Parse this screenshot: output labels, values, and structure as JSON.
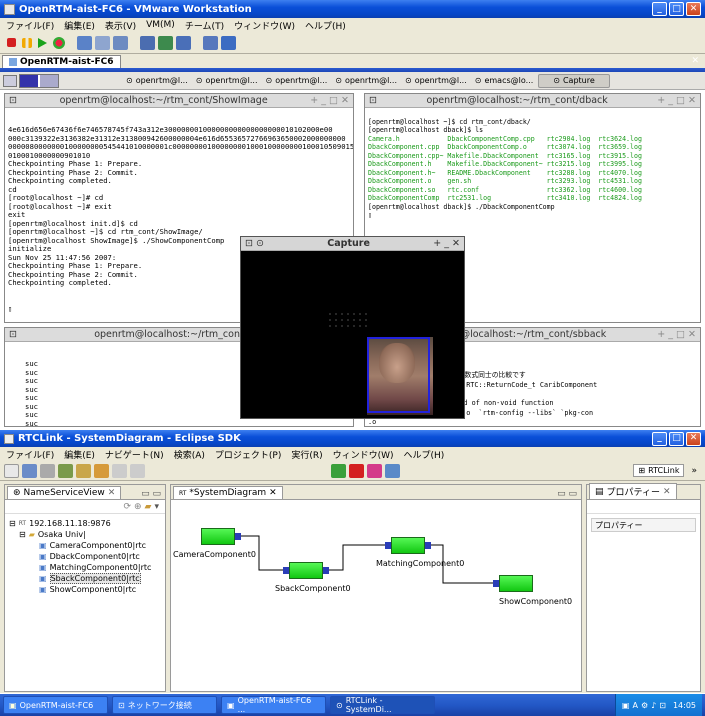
{
  "vmware": {
    "title": "OpenRTM-aist-FC6 - VMware Workstation",
    "menu": [
      "ファイル(F)",
      "編集(E)",
      "表示(V)",
      "VM(M)",
      "チーム(T)",
      "ウィンドウ(W)",
      "ヘルプ(H)"
    ],
    "tab_label": "OpenRTM-aist-FC6"
  },
  "gnome_panel": {
    "tasks": [
      "openrtm@l...",
      "openrtm@l...",
      "openrtm@l...",
      "openrtm@l...",
      "openrtm@l...",
      "emacs@lo...",
      "Capture"
    ]
  },
  "terminals": {
    "t1": {
      "title": "openrtm@localhost:~/rtm_cont/ShowImage",
      "lines": [
        "4e616d656e67436f6e746578745f743a312e300000001000000000000000000010102000e00",
        "000c3139322e3136382e31312e313800942600000004e616d65536572766963650002000000000",
        "0000080000000100000000545441010000001c000000001000000001000100000000100010509015",
        "0100010000000901010",
        "Checkpointing Phase 1: Prepare.",
        "Checkpointing Phase 2: Commit.",
        "Checkpointing completed.",
        "cd",
        "[root@localhost ~]# cd",
        "[root@localhost ~]# exit",
        "exit",
        "[openrtm@localhost init.d]$ cd",
        "[openrtm@localhost ~]$ cd rtm_cont/ShowImage/",
        "[openrtm@localhost ShowImage]$ ./ShowComponentComp",
        "initialize",
        "",
        "Sun Nov 25 11:47:56 2007:",
        "",
        "Checkpointing Phase 1: Prepare.",
        "Checkpointing Phase 2: Commit.",
        "Checkpointing completed."
      ]
    },
    "t2": {
      "title": "openrtm@localhost:~/rtm_cont/dback",
      "line1": "[openrtm@localhost ~]$ cd rtm_cont/dback/",
      "line2": "[openrtm@localhost dback]$ ls",
      "ls_rows": [
        [
          "Camera.h",
          "DbackComponentComp.cpp",
          "rtc2904.log",
          "rtc3624.log"
        ],
        [
          "DbackComponent.cpp",
          "DbackComponentComp.o",
          "rtc3074.log",
          "rtc3659.log"
        ],
        [
          "DbackComponent.cpp~",
          "Makefile.DbackComponent",
          "rtc3165.log",
          "rtc3915.log"
        ],
        [
          "DbackComponent.h",
          "Makefile.DbackComponent~",
          "rtc3215.log",
          "rtc3995.log"
        ],
        [
          "DbackComponent.h~",
          "README.DbackComponent",
          "rtc3288.log",
          "rtc4070.log"
        ],
        [
          "DbackComponent.o",
          "gen.sh",
          "rtc3293.log",
          "rtc4531.log"
        ],
        [
          "DbackComponent.so",
          "rtc.conf",
          "rtc3362.log",
          "rtc4600.log"
        ],
        [
          "DbackComponentComp",
          "rtc2531.log",
          "rtc3410.log",
          "rtc4824.log"
        ]
      ],
      "last": "[openrtm@localhost dback]$ ./DbackComponentComp"
    },
    "t3": {
      "title": "openrtm@localhost:~/rtm_cont/temp",
      "lines": [
        "suc",
        "suc",
        "suc",
        "suc",
        "suc",
        "suc",
        "suc",
        "suc",
        "suc",
        "suc",
        "suc"
      ]
    },
    "t4": {
      "title": "openrtm@localhost:~/rtm_cont/sbback",
      "lines": [
        "d)':",
        "警告: 符合付きと符合無しの整数式同士の比較です",
        "ember function 'virtual RTC::ReturnCode_t CaribComponent",
        "d)':",
        "警告: control reaches end of non-void function",
        "",
        "onent.so CaribComponent.o  `rtm-config --libs` `pkg-con",
        "",
        "",
        ".o"
      ]
    }
  },
  "capture": {
    "title": "Capture"
  },
  "eclipse": {
    "title": "RTCLink - SystemDiagram - Eclipse SDK",
    "menu": [
      "ファイル(F)",
      "編集(E)",
      "ナビゲート(N)",
      "検索(A)",
      "プロジェクト(P)",
      "実行(R)",
      "ウィンドウ(W)",
      "ヘルプ(H)"
    ],
    "perspective": "RTCLink",
    "name_service": {
      "tab": "NameServiceView",
      "host": "192.168.11.18:9876",
      "folder": "Osaka Univ|",
      "items": [
        "CameraComponent0|rtc",
        "DbackComponent0|rtc",
        "MatchingComponent0|rtc",
        "SbackComponent0|rtc",
        "ShowComponent0|rtc"
      ]
    },
    "diagram": {
      "tab": "*SystemDiagram",
      "components": [
        "CameraComponent0",
        "SbackComponent0",
        "MatchingComponent0",
        "ShowComponent0"
      ]
    },
    "properties": {
      "tab": "プロパティー",
      "header": "プロパティー"
    }
  },
  "taskbar": {
    "items": [
      "OpenRTM-aist-FC6",
      "ネットワーク接続",
      "OpenRTM-aist-FC6 ...",
      "RTCLink - SystemDi..."
    ],
    "clock": "14:05"
  }
}
